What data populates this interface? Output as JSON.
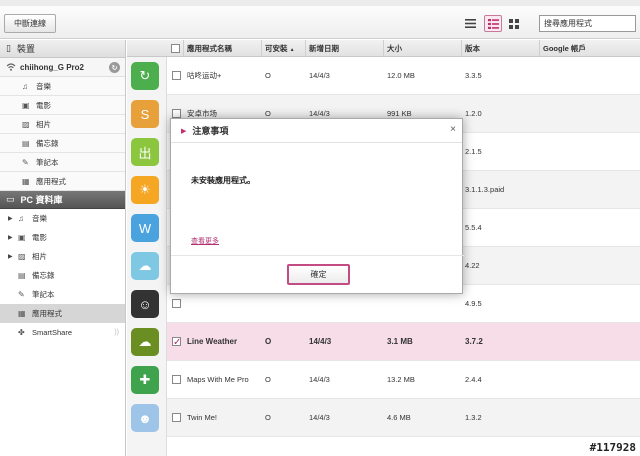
{
  "toolbar": {
    "disconnect_label": "中斷連線",
    "search_value": "搜尋應用程式"
  },
  "sidebar": {
    "device_header": "裝置",
    "device_name": "chiihong_G Pro2",
    "device_items": [
      {
        "label": "音樂",
        "icon": "music-icon"
      },
      {
        "label": "電影",
        "icon": "film-icon"
      },
      {
        "label": "相片",
        "icon": "photo-icon"
      },
      {
        "label": "備忘錄",
        "icon": "memo-icon"
      },
      {
        "label": "筆記本",
        "icon": "notebook-icon"
      },
      {
        "label": "應用程式",
        "icon": "app-icon"
      }
    ],
    "pc_header": "PC 資料庫",
    "pc_items": [
      {
        "label": "音樂",
        "icon": "music-icon"
      },
      {
        "label": "電影",
        "icon": "film-icon"
      },
      {
        "label": "相片",
        "icon": "photo-icon"
      },
      {
        "label": "備忘錄",
        "icon": "memo-icon"
      },
      {
        "label": "筆記本",
        "icon": "notebook-icon"
      },
      {
        "label": "應用程式",
        "icon": "app-icon"
      },
      {
        "label": "SmartShare",
        "icon": "smartshare-icon"
      }
    ]
  },
  "table": {
    "headers": {
      "name": "應用程式名稱",
      "installable": "可安裝",
      "sort_indicator": "▲",
      "date": "新增日期",
      "size": "大小",
      "version": "版本",
      "google": "Google 帳戶"
    },
    "rows": [
      {
        "name": "咕咚运动+",
        "installable": "O",
        "date": "14/4/3",
        "size": "12.0 MB",
        "version": "3.3.5"
      },
      {
        "name": "安卓市场",
        "installable": "O",
        "date": "14/4/3",
        "size": "991 KB",
        "version": "1.2.0"
      },
      {
        "name": "",
        "installable": "",
        "date": "",
        "size": "",
        "version": "2.1.5"
      },
      {
        "name": "",
        "installable": "",
        "date": "",
        "size": "",
        "version": "3.1.1.3.paid"
      },
      {
        "name": "",
        "installable": "",
        "date": "",
        "size": "",
        "version": "5.5.4"
      },
      {
        "name": "",
        "installable": "",
        "date": "",
        "size": "",
        "version": "4.22"
      },
      {
        "name": "",
        "installable": "",
        "date": "",
        "size": "",
        "version": "4.9.5"
      },
      {
        "name": "Line Weather",
        "installable": "O",
        "date": "14/4/3",
        "size": "3.1 MB",
        "version": "3.7.2"
      },
      {
        "name": "Maps With Me Pro",
        "installable": "O",
        "date": "14/4/3",
        "size": "13.2 MB",
        "version": "2.4.4"
      },
      {
        "name": "Twin Me!",
        "installable": "O",
        "date": "14/4/3",
        "size": "4.6 MB",
        "version": "1.3.2"
      }
    ]
  },
  "modal": {
    "title": "注意事項",
    "message": "未安裝應用程式。",
    "link": "查看更多",
    "ok_label": "確定",
    "close_glyph": "×"
  },
  "watermark": "#117928"
}
